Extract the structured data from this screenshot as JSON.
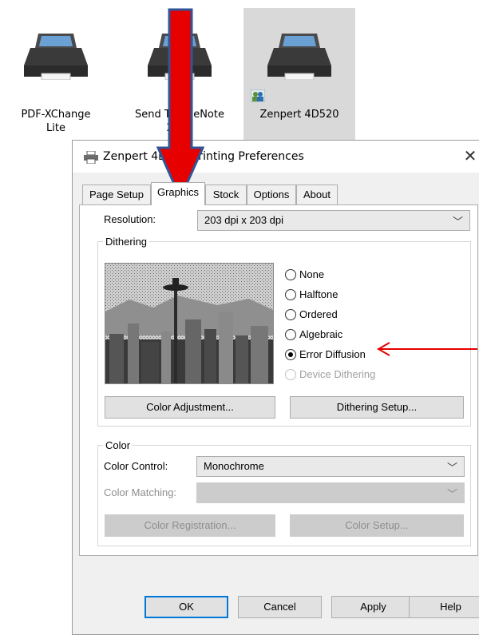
{
  "desktop": {
    "printers": [
      {
        "label_line1": "PDF-XChange",
        "label_line2": "Lite"
      },
      {
        "label_line1": "Send To OneNote",
        "label_line2": "2016"
      },
      {
        "label_line1": "Zenpert 4D520",
        "label_line2": ""
      }
    ]
  },
  "dialog": {
    "title": "Zenpert 4D520 Printing Preferences",
    "close_glyph": "✕",
    "tabs": [
      "Page Setup",
      "Graphics",
      "Stock",
      "Options",
      "About"
    ],
    "active_tab": "Graphics",
    "resolution": {
      "label": "Resolution:",
      "value": "203 dpi x 203 dpi"
    },
    "dithering": {
      "group_title": "Dithering",
      "options": [
        {
          "label": "None",
          "checked": false,
          "enabled": true
        },
        {
          "label": "Halftone",
          "checked": false,
          "enabled": true
        },
        {
          "label": "Ordered",
          "checked": false,
          "enabled": true
        },
        {
          "label": "Algebraic",
          "checked": false,
          "enabled": true
        },
        {
          "label": "Error Diffusion",
          "checked": true,
          "enabled": true
        },
        {
          "label": "Device Dithering",
          "checked": false,
          "enabled": false
        }
      ],
      "color_adjustment_button": "Color Adjustment...",
      "dithering_setup_button": "Dithering Setup..."
    },
    "color": {
      "group_title": "Color",
      "color_control_label": "Color Control:",
      "color_control_value": "Monochrome",
      "color_matching_label": "Color Matching:",
      "color_matching_value": "",
      "color_registration_button": "Color Registration...",
      "color_setup_button": "Color Setup..."
    },
    "footer": {
      "ok": "OK",
      "cancel": "Cancel",
      "apply": "Apply",
      "help": "Help"
    }
  },
  "colors": {
    "annotation_red": "#e60000",
    "arrow_outline": "#2f5597",
    "focus_blue": "#0078d7"
  }
}
